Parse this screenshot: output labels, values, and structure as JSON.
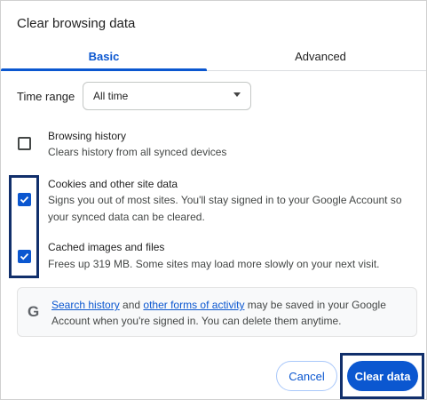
{
  "dialog": {
    "title": "Clear browsing data"
  },
  "tabs": [
    {
      "label": "Basic",
      "selected": true
    },
    {
      "label": "Advanced",
      "selected": false
    }
  ],
  "time_range": {
    "label": "Time range",
    "value": "All time"
  },
  "options": [
    {
      "title": "Browsing history",
      "description": [
        "Clears history from all synced devices"
      ],
      "checked": false
    },
    {
      "title": "Cookies and other site data",
      "description": [
        "Signs you out of most sites. You'll stay signed in to your Google Account so",
        "your synced data can be cleared."
      ],
      "checked": true
    },
    {
      "title": "Cached images and files",
      "description": [
        "Frees up 319 MB. Some sites may load more slowly on your next visit."
      ],
      "checked": true
    }
  ],
  "info": {
    "icon": "G",
    "link1": "Search history",
    "text1": " and ",
    "link2": "other forms of activity",
    "text2": " may be saved in your Google",
    "line2": "Account when you're signed in. You can delete them anytime."
  },
  "buttons": {
    "cancel": "Cancel",
    "clear": "Clear data"
  },
  "colors": {
    "accent": "#0b57d0",
    "highlight_border": "#112f6b"
  }
}
